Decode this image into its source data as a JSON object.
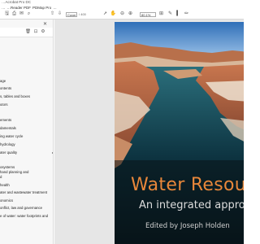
{
  "window": {
    "title": "…Acrobat Pro DC"
  },
  "menu": [
    "…",
    "…Reader PDF",
    "PDMap Pro",
    "…"
  ],
  "toolbar": {
    "page_label": "Cover",
    "page_count": "/ 400",
    "zoom": "80.1%"
  },
  "bookmarks": [
    "age",
    "ontents",
    "s, tables and boxes",
    "utors",
    "ements",
    "damentals",
    "ing water cycle",
    "hydrology",
    "ater quality",
    "osystems",
    "hand planning and",
    "d",
    "health",
    "ater and wastewater treatment",
    "onomics",
    "onflict, law and governance",
    "e of water: water footprints and"
  ],
  "cover": {
    "title": "Water Resour",
    "subtitle": "An integrated approac",
    "editor": "Edited by Joseph Holden"
  }
}
